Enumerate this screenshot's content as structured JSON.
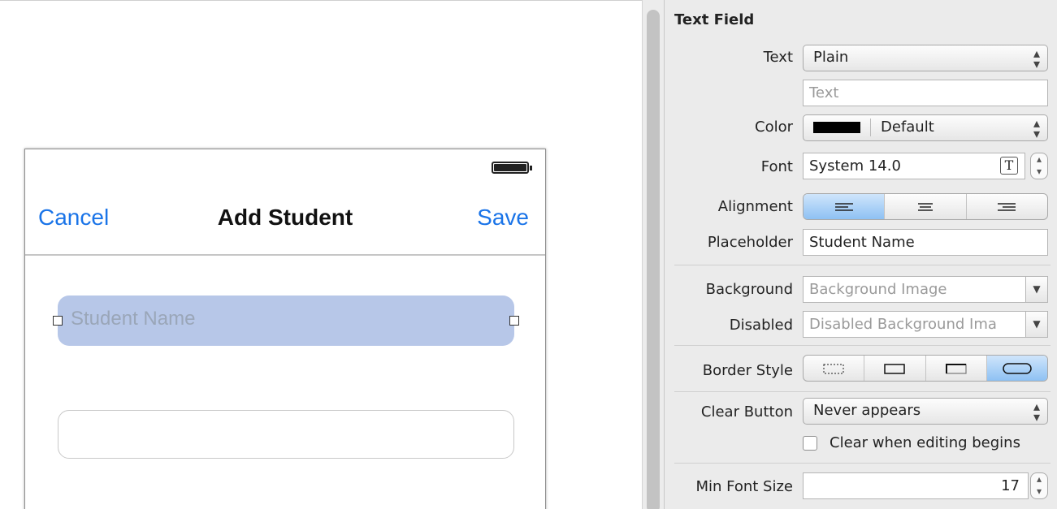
{
  "canvas": {
    "nav": {
      "cancel": "Cancel",
      "title": "Add Student",
      "save": "Save"
    },
    "text_field_1": {
      "placeholder": "Student Name"
    },
    "text_field_2": {
      "value": ""
    }
  },
  "inspector": {
    "section_title": "Text Field",
    "text": {
      "label": "Text",
      "value": "Plain",
      "placeholder": "Text"
    },
    "color": {
      "label": "Color",
      "value": "Default",
      "swatch": "#000000"
    },
    "font": {
      "label": "Font",
      "value": "System 14.0"
    },
    "alignment": {
      "label": "Alignment",
      "options": [
        "left",
        "center",
        "right"
      ],
      "selected": "left"
    },
    "placeholder": {
      "label": "Placeholder",
      "value": "Student Name"
    },
    "background": {
      "label": "Background",
      "placeholder": "Background Image"
    },
    "disabled": {
      "label": "Disabled",
      "placeholder": "Disabled Background Ima"
    },
    "border_style": {
      "label": "Border Style",
      "options": [
        "none",
        "line",
        "bezel",
        "rounded"
      ],
      "selected": "rounded"
    },
    "clear_button": {
      "label": "Clear Button",
      "value": "Never appears"
    },
    "clear_when_editing": {
      "label": "Clear when editing begins",
      "checked": false
    },
    "min_font_size": {
      "label": "Min Font Size",
      "value": "17"
    }
  },
  "colors": {
    "ios_blue": "#1a74e8",
    "selection": "#b7c7e8",
    "segment_on": "#8ec1f3"
  }
}
